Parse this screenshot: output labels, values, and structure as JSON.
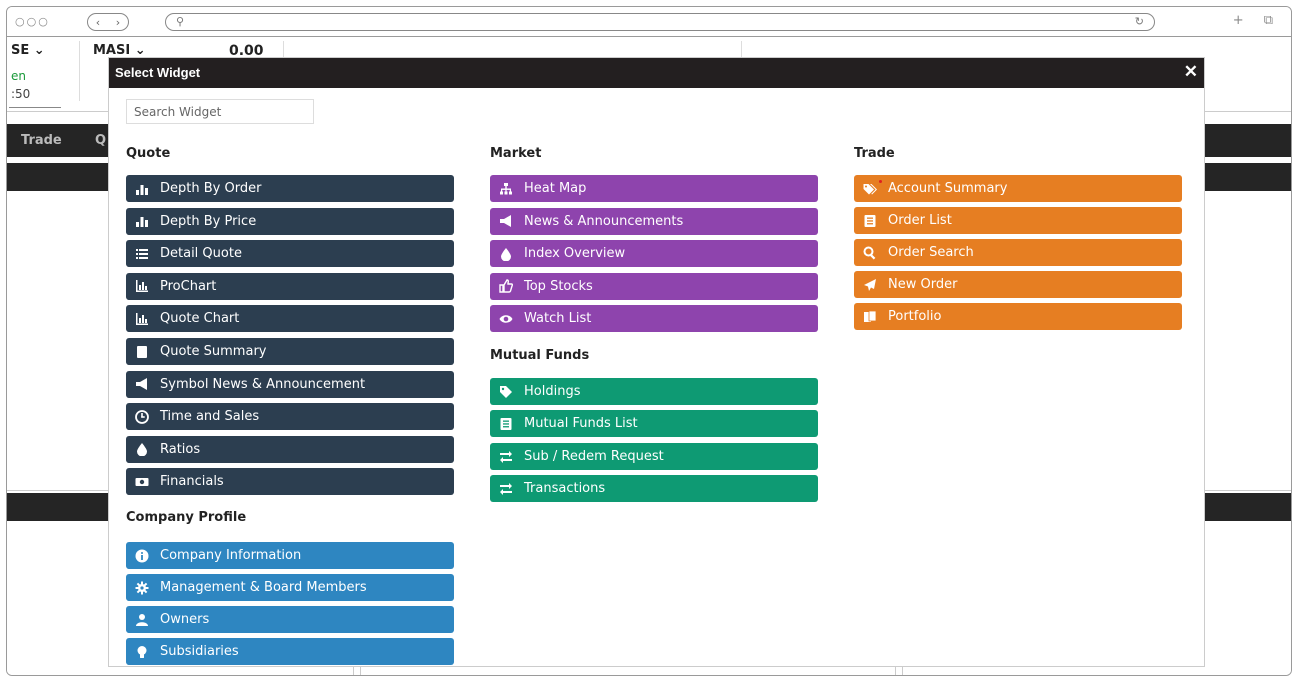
{
  "browser": {
    "traffic": "○○○",
    "nav_back": "‹",
    "nav_forward": "›",
    "search_glyph": "⚲",
    "reload_glyph": "↻",
    "right_icons": "+ ⧉"
  },
  "background": {
    "exchange_label": "SE ⌄",
    "status": "en",
    "time": ":50",
    "index_name": "MASI ⌄",
    "index_value": "0.00",
    "tab_trade": "Trade",
    "tab_q": "Q"
  },
  "modal": {
    "title": "Select Widget",
    "close": "✕",
    "search_placeholder": "Search Widget",
    "sections": {
      "quote": {
        "title": "Quote",
        "items": [
          {
            "label": "Depth By Order",
            "icon": "bar-chart-icon"
          },
          {
            "label": "Depth By Price",
            "icon": "bar-chart-icon"
          },
          {
            "label": "Detail Quote",
            "icon": "list-icon"
          },
          {
            "label": "ProChart",
            "icon": "area-chart-icon"
          },
          {
            "label": "Quote Chart",
            "icon": "area-chart-icon"
          },
          {
            "label": "Quote Summary",
            "icon": "book-icon"
          },
          {
            "label": "Symbol News & Announcement",
            "icon": "megaphone-icon"
          },
          {
            "label": "Time and Sales",
            "icon": "clock-icon"
          },
          {
            "label": "Ratios",
            "icon": "drop-icon"
          },
          {
            "label": "Financials",
            "icon": "money-icon"
          }
        ]
      },
      "company": {
        "title": "Company Profile",
        "items": [
          {
            "label": "Company Information",
            "icon": "info-icon"
          },
          {
            "label": "Management & Board Members",
            "icon": "gear-icon"
          },
          {
            "label": "Owners",
            "icon": "user-icon"
          },
          {
            "label": "Subsidiaries",
            "icon": "bulb-icon"
          }
        ]
      },
      "market": {
        "title": "Market",
        "items": [
          {
            "label": "Heat Map",
            "icon": "sitemap-icon"
          },
          {
            "label": "News & Announcements",
            "icon": "megaphone-icon"
          },
          {
            "label": "Index Overview",
            "icon": "drop-icon"
          },
          {
            "label": "Top Stocks",
            "icon": "thumbs-up-icon"
          },
          {
            "label": "Watch List",
            "icon": "eye-icon"
          }
        ]
      },
      "mutual_funds": {
        "title": "Mutual Funds",
        "items": [
          {
            "label": "Holdings",
            "icon": "tag-icon"
          },
          {
            "label": "Mutual Funds List",
            "icon": "list-alt-icon"
          },
          {
            "label": "Sub / Redem Request",
            "icon": "exchange-icon"
          },
          {
            "label": "Transactions",
            "icon": "exchange-icon"
          }
        ]
      },
      "trade": {
        "title": "Trade",
        "items": [
          {
            "label": "Account Summary",
            "icon": "tags-icon"
          },
          {
            "label": "Order List",
            "icon": "list-alt-icon"
          },
          {
            "label": "Order Search",
            "icon": "search-icon"
          },
          {
            "label": "New Order",
            "icon": "paper-plane-icon"
          },
          {
            "label": "Portfolio",
            "icon": "files-icon"
          }
        ]
      }
    }
  },
  "colors": {
    "quote": "#2c3e50",
    "market": "#8e44ad",
    "trade": "#e67e22",
    "mutual_funds": "#0e9a73",
    "company": "#2e86c1",
    "header": "#231f20"
  }
}
